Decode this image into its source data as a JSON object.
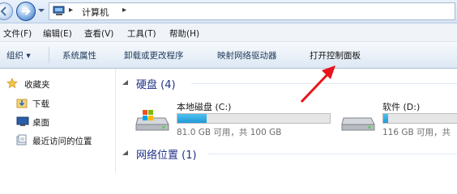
{
  "address": {
    "separator": "▸",
    "crumb": "计算机"
  },
  "menu": [
    "文件(F)",
    "编辑(E)",
    "查看(V)",
    "工具(T)",
    "帮助(H)"
  ],
  "commands": {
    "organize": "组织 ▾",
    "system_properties": "系统属性",
    "uninstall": "卸载或更改程序",
    "map_drive": "映射网络驱动器",
    "control_panel": "打开控制面板"
  },
  "nav": {
    "favorites": "收藏夹",
    "downloads": "下载",
    "desktop": "桌面",
    "recent": "最近访问的位置"
  },
  "groups": {
    "hard_disks": "硬盘 (4)",
    "network": "网络位置 (1)"
  },
  "drives": [
    {
      "name": "本地磁盘 (C:)",
      "free_text": "81.0 GB 可用，共 100 GB",
      "used_fraction": 0.19
    },
    {
      "name": "软件 (D:)",
      "free_text": "116 GB 可用，共",
      "used_fraction": 0.06
    }
  ],
  "colors": {
    "annotation_red": "#e8141c",
    "drive_bar": "#26a2dd",
    "group_heading": "#1e3287"
  },
  "icons": [
    "back-arrow-icon",
    "forward-arrow-icon",
    "computer-icon",
    "star-icon",
    "folder-download-icon",
    "desktop-icon",
    "recent-places-icon",
    "hard-drive-icon"
  ]
}
